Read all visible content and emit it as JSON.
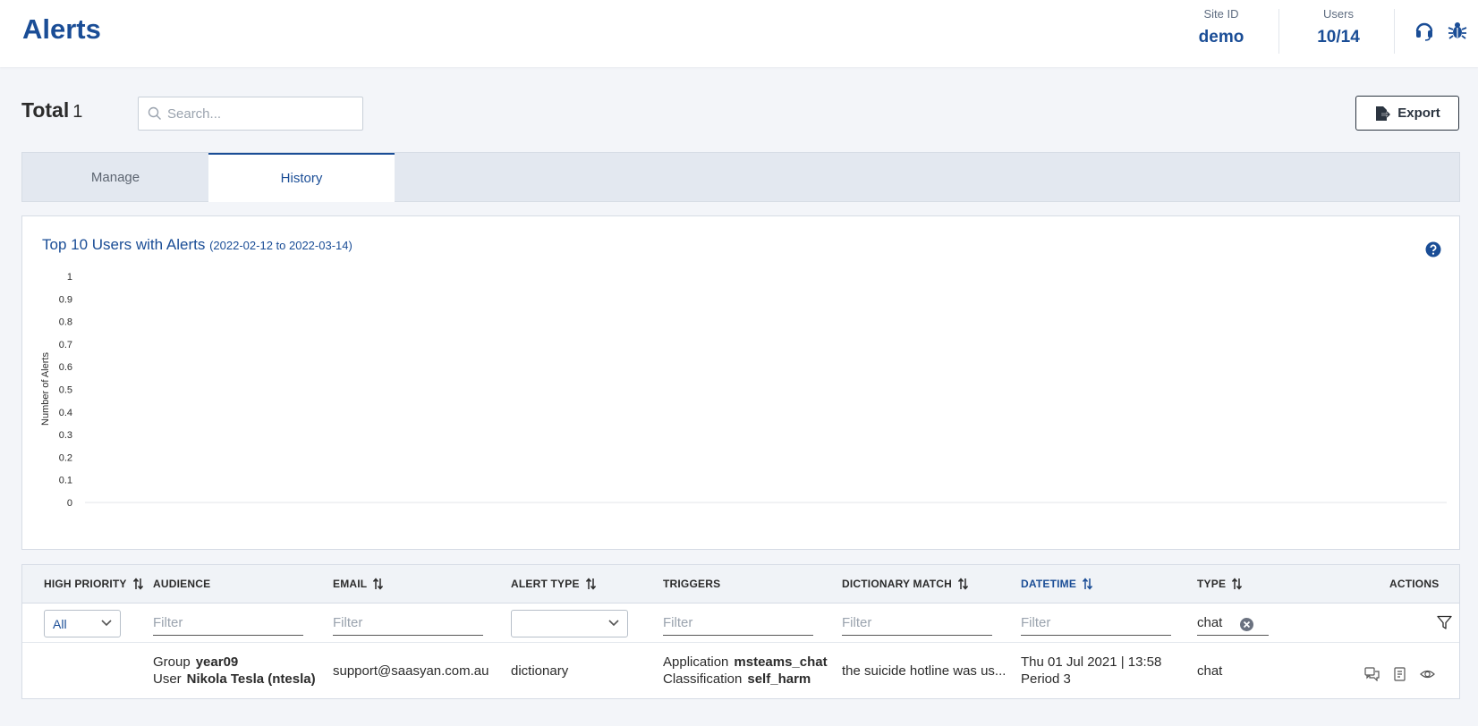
{
  "header": {
    "title": "Alerts",
    "site_id_label": "Site ID",
    "site_id_value": "demo",
    "users_label": "Users",
    "users_value": "10/14"
  },
  "toolbar": {
    "total_label": "Total",
    "total_count": "1",
    "search_placeholder": "Search...",
    "export_label": "Export"
  },
  "tabs": [
    {
      "label": "Manage",
      "active": false
    },
    {
      "label": "History",
      "active": true
    }
  ],
  "chart_data": {
    "type": "bar",
    "title": "Top 10 Users with Alerts",
    "subtitle": "(2022-02-12 to 2022-03-14)",
    "xlabel": "",
    "ylabel": "Number of Alerts",
    "ylim": [
      0,
      1
    ],
    "yticks": [
      "0",
      "0.1",
      "0.2",
      "0.3",
      "0.4",
      "0.5",
      "0.6",
      "0.7",
      "0.8",
      "0.9",
      "1"
    ],
    "categories": [],
    "values": []
  },
  "table": {
    "columns": [
      {
        "label": "HIGH PRIORITY",
        "sortable": true,
        "active": false
      },
      {
        "label": "AUDIENCE",
        "sortable": false,
        "active": false
      },
      {
        "label": "EMAIL",
        "sortable": true,
        "active": false
      },
      {
        "label": "ALERT TYPE",
        "sortable": true,
        "active": false
      },
      {
        "label": "TRIGGERS",
        "sortable": false,
        "active": false
      },
      {
        "label": "DICTIONARY MATCH",
        "sortable": true,
        "active": false
      },
      {
        "label": "DATETIME",
        "sortable": true,
        "active": true
      },
      {
        "label": "TYPE",
        "sortable": true,
        "active": false
      },
      {
        "label": "ACTIONS",
        "sortable": false,
        "active": false
      }
    ],
    "filters": {
      "priority_selected": "All",
      "audience_placeholder": "Filter",
      "email_placeholder": "Filter",
      "alert_type_selected": "",
      "triggers_placeholder": "Filter",
      "dictionary_placeholder": "Filter",
      "datetime_placeholder": "Filter",
      "type_value": "chat"
    },
    "rows": [
      {
        "group_label": "Group",
        "group_value": "year09",
        "user_label": "User",
        "user_value": "Nikola Tesla (ntesla)",
        "email": "support@saasyan.com.au",
        "alert_type": "dictionary",
        "application_label": "Application",
        "application_value": "msteams_chat",
        "classification_label": "Classification",
        "classification_value": "self_harm",
        "dictionary_match": "the suicide hotline was us...",
        "datetime": "Thu 01 Jul 2021 | 13:58",
        "period": "Period 3",
        "type": "chat"
      }
    ]
  },
  "colors": {
    "brand": "#1a4d96",
    "background": "#f3f5f9"
  }
}
